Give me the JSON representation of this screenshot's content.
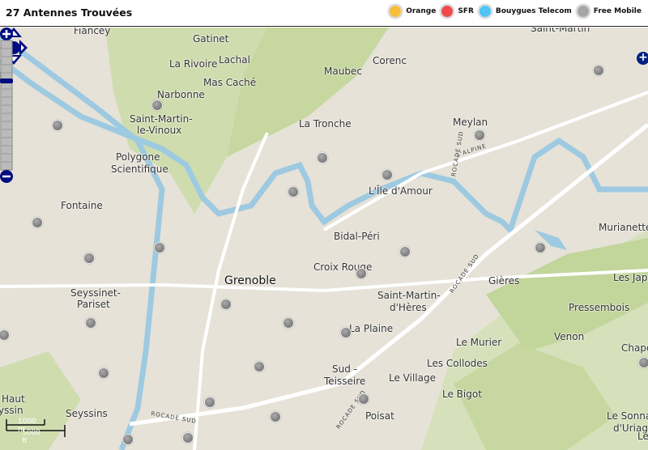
{
  "header": {
    "title": "27 Antennes Trouvées"
  },
  "legend": [
    {
      "label": "Orange",
      "color": "#f7bd3c"
    },
    {
      "label": "SFR",
      "color": "#f04a4a"
    },
    {
      "label": "Bouygues Telecom",
      "color": "#4fc4f5"
    },
    {
      "label": "Free Mobile",
      "color": "#a6a6a6"
    }
  ],
  "map": {
    "places": [
      "Fiancey",
      "Gatinet",
      "La Rivoire",
      "Lachal",
      "Mas Caché",
      "Narbonne",
      "Saint-Martin-",
      "le-Vinoux",
      "Polygone",
      "Scientifique",
      "Fontaine",
      "Maubec",
      "Corenc",
      "La Tronche",
      "Meylan",
      "Saint-Martin",
      "L'Île d'Amour",
      "Bidal-Péri",
      "Croix Rouge",
      "Grenoble",
      "Saint-Martin-",
      "d'Hères",
      "Gières",
      "Murianette",
      "Les Japin",
      "Pressembois",
      "Venon",
      "Le Murier",
      "Les Collodes",
      "Chapo",
      "La Plaine",
      "Sud -",
      "Teisseire",
      "Le Village",
      "Le Bigot",
      "Poisat",
      "Seyssinet-",
      "Pariset",
      "Seyssins",
      "Haut",
      "yssin",
      "Le Sonna",
      "d'Uriage",
      "Les C"
    ],
    "roads": [
      "L'ALPINE",
      "ROCADE SUD",
      "ROCADE SUD",
      "ROCADE SUD",
      "ROCADE SUD"
    ],
    "scale": {
      "metric": "1000 m",
      "imperial": "5000 ft"
    },
    "antenna_count": 27,
    "antenna_operator": "Free Mobile"
  }
}
